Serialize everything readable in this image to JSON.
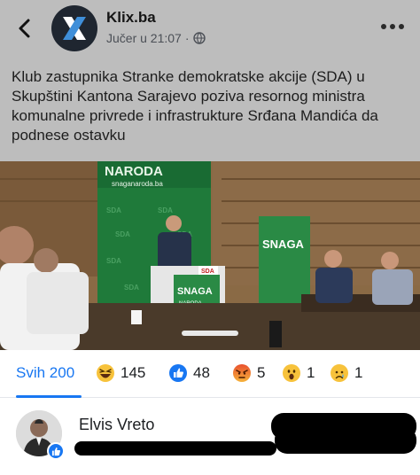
{
  "post": {
    "page_name": "Klix.ba",
    "timestamp": "Jučer u 21:07",
    "separator": "·",
    "caption": "Klub zastupnika Stranke demokratske akcije (SDA) u Skupštini Kantona Sarajevo poziva resornog ministra komunalne privrede i infrastrukture Srđana Mandića da podnese ostavku",
    "photo_banner_text": "NARODA",
    "photo_banner_url": "snaganaroda.ba",
    "photo_sign_text": "SNAGA",
    "photo_sign_sub": "NARODA",
    "photo_sign_alt": "SNAGA",
    "logo_text": "SDA"
  },
  "reactions": {
    "tabs": [
      {
        "label": "Svih 200",
        "icon": "all",
        "active": true
      },
      {
        "count": "145",
        "icon": "haha-icon"
      },
      {
        "count": "48",
        "icon": "like-icon"
      },
      {
        "count": "5",
        "icon": "angry-icon"
      },
      {
        "count": "1",
        "icon": "wow-icon"
      },
      {
        "count": "1",
        "icon": "sad-icon"
      }
    ],
    "accent": "#1877f2"
  },
  "users": [
    {
      "name": "Elvis Vreto",
      "reaction": "like-icon"
    }
  ]
}
